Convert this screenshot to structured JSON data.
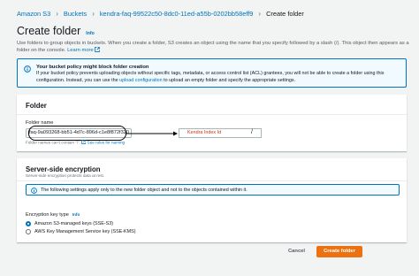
{
  "breadcrumb": {
    "items": [
      "Amazon S3",
      "Buckets",
      "kendra-faq-99522c50-8dc0-11ed-a55b-0202bb58eff9",
      "Create folder"
    ],
    "separator": "›"
  },
  "page": {
    "title": "Create folder",
    "info_label": "Info",
    "description_part1": "Use folders to group objects in buckets. When you create a folder, S3 creates an object using the name that you specify followed by a slash (/). This object then appears as a folder on the console.",
    "learn_more": "Learn more"
  },
  "alert": {
    "title": "Your bucket policy might block folder creation",
    "body_part1": "If your bucket policy prevents uploading objects without specific tags, metadata, or access control list (ACL) grantees, you will not be able to create a folder using this configuration. Instead, you can use the",
    "body_link": "upload configuration",
    "body_part2": "to upload an empty folder and specify the appropriate settings."
  },
  "folder_panel": {
    "header": "Folder",
    "field_label": "Folder name",
    "input_value": "faq-9a093268-bb51-4d7c-896d-c1e8f872f320",
    "annotation": "Kendra Index Id",
    "slash": "/",
    "hint_text": "Folder names can't contain \"/\".",
    "hint_link": "See rules for naming"
  },
  "encryption_panel": {
    "header": "Server-side encryption",
    "description": "Server-side encryption protects data at rest.",
    "info_text": "The following settings apply only to the new folder object and not to the objects contained within it.",
    "key_type_label": "Encryption key type",
    "key_type_info": "Info",
    "options": [
      {
        "label": "Amazon S3-managed keys (SSE-S3)",
        "selected": true
      },
      {
        "label": "AWS Key Management Service key (SSE-KMS)",
        "selected": false
      }
    ]
  },
  "footer": {
    "cancel_label": "Cancel",
    "create_label": "Create folder"
  },
  "colors": {
    "link": "#0073bb",
    "primary_button": "#ec7211",
    "annotation_text": "#d13212",
    "info_border": "#0073bb"
  }
}
